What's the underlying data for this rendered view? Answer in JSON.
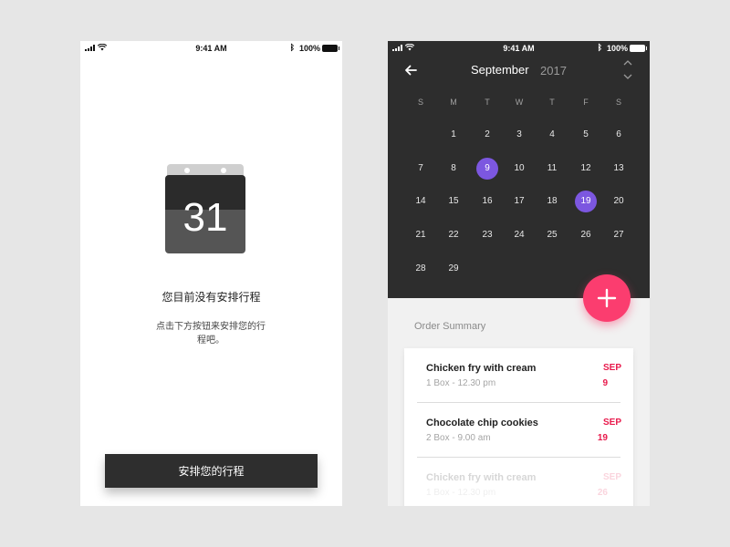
{
  "status_bar": {
    "time": "9:41 AM",
    "battery": "100%"
  },
  "empty_screen": {
    "calendar_day": "31",
    "title": "您目前没有安排行程",
    "description": "点击下方按钮来安排您的行程吧。",
    "button_label": "安排您的行程",
    "colors": {
      "button": "#2e2e2e"
    }
  },
  "calendar_screen": {
    "month": "September",
    "year": "2017",
    "weekdays": [
      "S",
      "M",
      "T",
      "W",
      "T",
      "F",
      "S"
    ],
    "weeks": [
      [
        "",
        "1",
        "2",
        "3",
        "4",
        "5",
        "6"
      ],
      [
        "7",
        "8",
        "9",
        "10",
        "11",
        "12",
        "13"
      ],
      [
        "14",
        "15",
        "16",
        "17",
        "18",
        "19",
        "20"
      ],
      [
        "21",
        "22",
        "23",
        "24",
        "25",
        "26",
        "27"
      ],
      [
        "28",
        "29",
        "",
        "",
        "",
        "",
        ""
      ]
    ],
    "selected_days": [
      "9",
      "19"
    ],
    "order_summary_title": "Order Summary",
    "orders": [
      {
        "name": "Chicken fry with cream",
        "detail": "1 Box - 12.30 pm",
        "month": "SEP",
        "day": "9"
      },
      {
        "name": "Chocolate chip cookies",
        "detail": "2 Box - 9.00 am",
        "month": "SEP",
        "day": "19"
      },
      {
        "name": "Chicken fry with cream",
        "detail": "1 Box - 12.30 pm",
        "month": "SEP",
        "day": "26"
      }
    ],
    "colors": {
      "panel": "#2d2d2d",
      "selected": "#7c57e0",
      "fab": "#fb3d6f",
      "date_text": "#e8194b"
    }
  }
}
